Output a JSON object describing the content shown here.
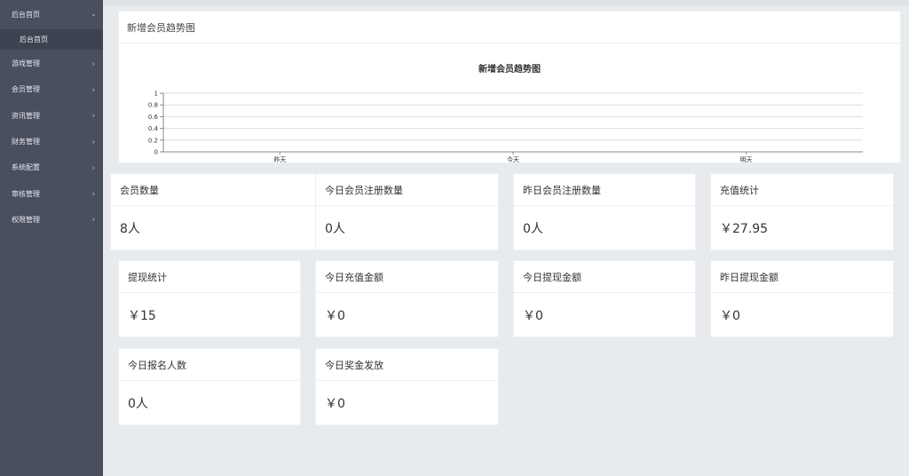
{
  "sidebar": {
    "items": [
      {
        "label": "后台首页",
        "open": true,
        "children": [
          {
            "label": "后台首页"
          }
        ]
      },
      {
        "label": "游戏管理"
      },
      {
        "label": "会员管理"
      },
      {
        "label": "资讯管理"
      },
      {
        "label": "财务管理"
      },
      {
        "label": "系统配置"
      },
      {
        "label": "审核管理"
      },
      {
        "label": "权限管理"
      }
    ]
  },
  "chart_panel": {
    "title": "新增会员趋势图"
  },
  "chart_data": {
    "type": "line",
    "title": "新增会员趋势图",
    "categories": [
      "昨天",
      "今天",
      "明天"
    ],
    "yticks": [
      "0",
      "0.2",
      "0.4",
      "0.6",
      "0.8",
      "1"
    ],
    "ylim": [
      0,
      1
    ],
    "grid": true,
    "series": []
  },
  "cards": [
    {
      "label": "会员数量",
      "value": "8人"
    },
    {
      "label": "今日会员注册数量",
      "value": "0人"
    },
    {
      "label": "昨日会员注册数量",
      "value": "0人"
    },
    {
      "label": "充值统计",
      "value": "￥27.95"
    },
    {
      "label": "提现统计",
      "value": "￥15"
    },
    {
      "label": "今日充值金额",
      "value": "￥0"
    },
    {
      "label": "今日提现金额",
      "value": "￥0"
    },
    {
      "label": "昨日提现金额",
      "value": "￥0"
    },
    {
      "label": "今日报名人数",
      "value": "0人"
    },
    {
      "label": "今日奖金发放",
      "value": "￥0"
    }
  ]
}
